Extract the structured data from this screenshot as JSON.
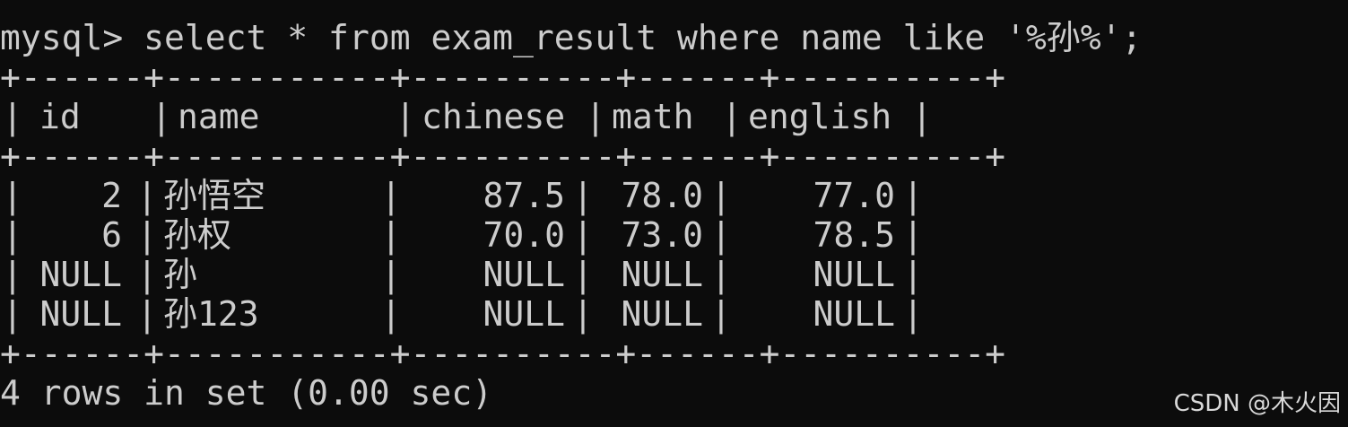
{
  "terminal": {
    "prompt": "mysql>",
    "command": " select * from exam_result where name like '%孙%';",
    "border_line": "+------+-----------+----------+------+----------+",
    "columns": [
      "id",
      "name",
      "chinese",
      "math",
      "english"
    ],
    "rows": [
      {
        "id": "2",
        "name": "孙悟空",
        "chinese": "87.5",
        "math": "78.0",
        "english": "77.0"
      },
      {
        "id": "6",
        "name": "孙权",
        "chinese": "70.0",
        "math": "73.0",
        "english": "78.5"
      },
      {
        "id": "NULL",
        "name": "孙",
        "chinese": "NULL",
        "math": "NULL",
        "english": "NULL"
      },
      {
        "id": "NULL",
        "name": "孙123",
        "chinese": "NULL",
        "math": "NULL",
        "english": "NULL"
      }
    ],
    "footer": "4 rows in set (0.00 sec)"
  },
  "watermark": "CSDN @木火因",
  "colors": {
    "background": "#0c0c0c",
    "text": "#cccccc"
  }
}
